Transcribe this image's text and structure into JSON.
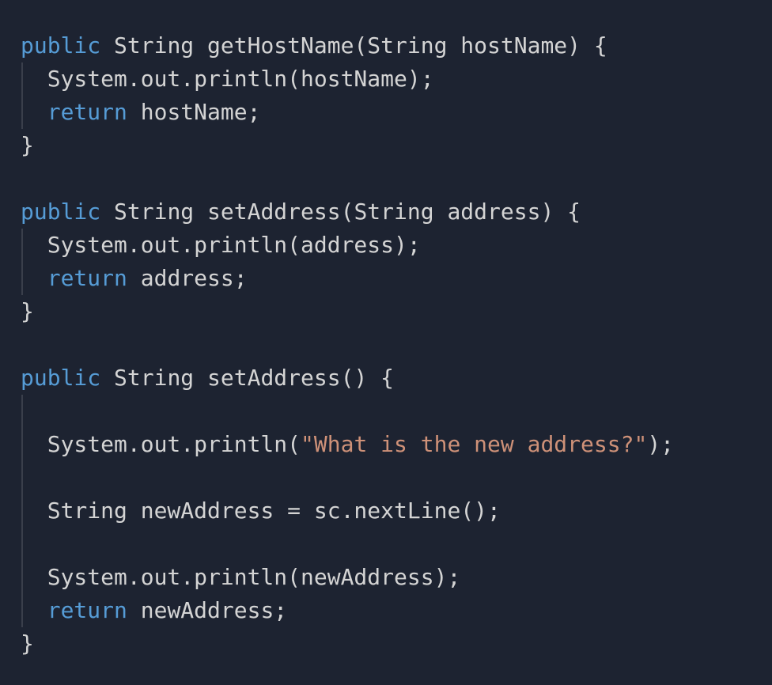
{
  "colors": {
    "background": "#1d2331",
    "keyword": "#569cd6",
    "string": "#ce9178",
    "text": "#d4d4d4"
  },
  "lines": [
    {
      "indent": 0,
      "tokens": [
        {
          "t": "kw",
          "v": "public"
        },
        {
          "t": "plain",
          "v": " String getHostName(String hostName) {"
        }
      ]
    },
    {
      "indent": 1,
      "tokens": [
        {
          "t": "plain",
          "v": "  System.out.println(hostName);"
        }
      ]
    },
    {
      "indent": 1,
      "tokens": [
        {
          "t": "plain",
          "v": "  "
        },
        {
          "t": "kw",
          "v": "return"
        },
        {
          "t": "plain",
          "v": " hostName;"
        }
      ]
    },
    {
      "indent": 0,
      "tokens": [
        {
          "t": "plain",
          "v": "}"
        }
      ]
    },
    {
      "indent": 0,
      "tokens": []
    },
    {
      "indent": 0,
      "tokens": [
        {
          "t": "kw",
          "v": "public"
        },
        {
          "t": "plain",
          "v": " String setAddress(String address) {"
        }
      ]
    },
    {
      "indent": 1,
      "tokens": [
        {
          "t": "plain",
          "v": "  System.out.println(address);"
        }
      ]
    },
    {
      "indent": 1,
      "tokens": [
        {
          "t": "plain",
          "v": "  "
        },
        {
          "t": "kw",
          "v": "return"
        },
        {
          "t": "plain",
          "v": " address;"
        }
      ]
    },
    {
      "indent": 0,
      "tokens": [
        {
          "t": "plain",
          "v": "}"
        }
      ]
    },
    {
      "indent": 0,
      "tokens": []
    },
    {
      "indent": 0,
      "tokens": [
        {
          "t": "kw",
          "v": "public"
        },
        {
          "t": "plain",
          "v": " String setAddress() {"
        }
      ]
    },
    {
      "indent": 1,
      "tokens": []
    },
    {
      "indent": 1,
      "tokens": [
        {
          "t": "plain",
          "v": "  System.out.println("
        },
        {
          "t": "str",
          "v": "\"What is the new address?\""
        },
        {
          "t": "plain",
          "v": ");"
        }
      ]
    },
    {
      "indent": 1,
      "tokens": []
    },
    {
      "indent": 1,
      "tokens": [
        {
          "t": "plain",
          "v": "  String newAddress = sc.nextLine();"
        }
      ]
    },
    {
      "indent": 1,
      "tokens": []
    },
    {
      "indent": 1,
      "tokens": [
        {
          "t": "plain",
          "v": "  System.out.println(newAddress);"
        }
      ]
    },
    {
      "indent": 1,
      "tokens": [
        {
          "t": "plain",
          "v": "  "
        },
        {
          "t": "kw",
          "v": "return"
        },
        {
          "t": "plain",
          "v": " newAddress;"
        }
      ]
    },
    {
      "indent": 0,
      "tokens": [
        {
          "t": "plain",
          "v": "}"
        }
      ]
    }
  ]
}
